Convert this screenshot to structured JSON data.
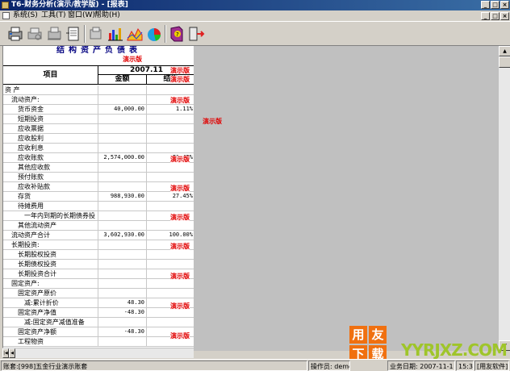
{
  "window": {
    "title": "T6-财务分析(演示/教学版)    - [报表]",
    "min_label": "_",
    "max_label": "□",
    "close_label": "×"
  },
  "menu": [
    {
      "label": "系统(S)"
    },
    {
      "label": "工具(T)"
    },
    {
      "label": "窗口(W)"
    },
    {
      "label": "帮助(H)"
    }
  ],
  "toolbar_icons": [
    "printer-icon",
    "print-preview-icon",
    "setup-icon",
    "export-icon",
    "copy-icon",
    "bar-chart-icon",
    "line-chart-icon",
    "pie-chart-icon",
    "help-book-icon",
    "exit-icon"
  ],
  "report": {
    "title": "结构资产负债表",
    "watermark": "演示版",
    "col_item": "项目",
    "period": "2007.11",
    "col_amount": "金额",
    "col_struct": "结构",
    "rows": [
      {
        "label": "资    产",
        "indent": 0,
        "amount": "",
        "pct": ""
      },
      {
        "label": "流动资产:",
        "indent": 1,
        "amount": "",
        "pct": ""
      },
      {
        "label": "货币资金",
        "indent": 2,
        "amount": "40,000.00",
        "pct": "1.11%"
      },
      {
        "label": "短期投资",
        "indent": 2,
        "amount": "",
        "pct": ""
      },
      {
        "label": "应收票据",
        "indent": 2,
        "amount": "",
        "pct": ""
      },
      {
        "label": "应收股利",
        "indent": 2,
        "amount": "",
        "pct": ""
      },
      {
        "label": "应收利息",
        "indent": 2,
        "amount": "",
        "pct": ""
      },
      {
        "label": "应收账款",
        "indent": 2,
        "amount": "2,574,000.00",
        "pct": "71.45%"
      },
      {
        "label": "其他应收款",
        "indent": 2,
        "amount": "",
        "pct": ""
      },
      {
        "label": "预付账款",
        "indent": 2,
        "amount": "",
        "pct": ""
      },
      {
        "label": "应收补贴款",
        "indent": 2,
        "amount": "",
        "pct": ""
      },
      {
        "label": "存货",
        "indent": 2,
        "amount": "988,930.00",
        "pct": "27.45%"
      },
      {
        "label": "待摊费用",
        "indent": 2,
        "amount": "",
        "pct": ""
      },
      {
        "label": "一年内到期的长期债券投",
        "indent": 3,
        "amount": "",
        "pct": ""
      },
      {
        "label": "其他流动资产",
        "indent": 2,
        "amount": "",
        "pct": ""
      },
      {
        "label": "流动资产合计",
        "indent": 1,
        "amount": "3,602,930.00",
        "pct": "100.00%"
      },
      {
        "label": "长期投资:",
        "indent": 1,
        "amount": "",
        "pct": ""
      },
      {
        "label": "长期股权投资",
        "indent": 2,
        "amount": "",
        "pct": ""
      },
      {
        "label": "长期债权投资",
        "indent": 2,
        "amount": "",
        "pct": ""
      },
      {
        "label": "长期投资合计",
        "indent": 2,
        "amount": "",
        "pct": ""
      },
      {
        "label": "固定资产:",
        "indent": 1,
        "amount": "",
        "pct": ""
      },
      {
        "label": "固定资产原价",
        "indent": 2,
        "amount": "",
        "pct": ""
      },
      {
        "label": "减:累计折价",
        "indent": 3,
        "amount": "48.30",
        "pct": ""
      },
      {
        "label": "固定资产净值",
        "indent": 2,
        "amount": "-48.30",
        "pct": ""
      },
      {
        "label": "减:固定资产减值准备",
        "indent": 3,
        "amount": "",
        "pct": ""
      },
      {
        "label": "固定资产净额",
        "indent": 2,
        "amount": "-48.30",
        "pct": ""
      },
      {
        "label": "工程物资",
        "indent": 2,
        "amount": "",
        "pct": ""
      }
    ]
  },
  "status": {
    "account": "账套:[998]五金行业演示账套",
    "operator": "操作员: demo",
    "biz_date": "业务日期: 2007-11-1",
    "time": "15:31",
    "company": "[用友软件]"
  },
  "logo": {
    "tile1": "用",
    "tile2": "友",
    "tile3": "下",
    "tile4": "载",
    "site": "YYRJXZ.COM"
  }
}
